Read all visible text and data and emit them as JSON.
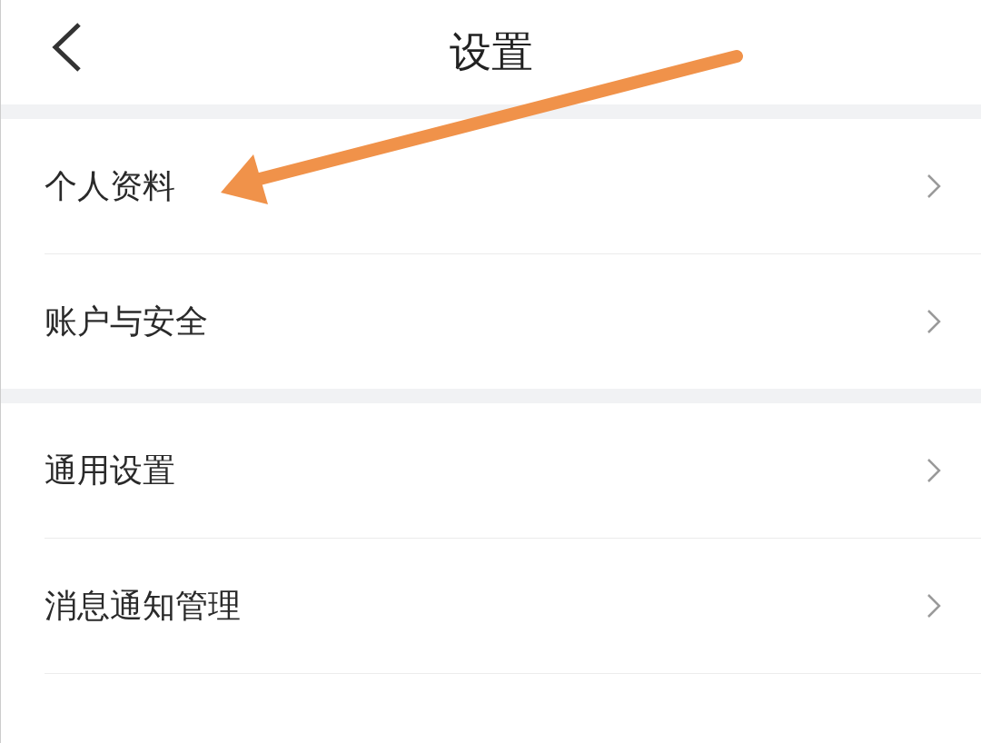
{
  "header": {
    "title": "设置"
  },
  "sections": [
    {
      "items": [
        {
          "label": "个人资料"
        },
        {
          "label": "账户与安全"
        }
      ]
    },
    {
      "items": [
        {
          "label": "通用设置"
        },
        {
          "label": "消息通知管理"
        }
      ]
    }
  ]
}
